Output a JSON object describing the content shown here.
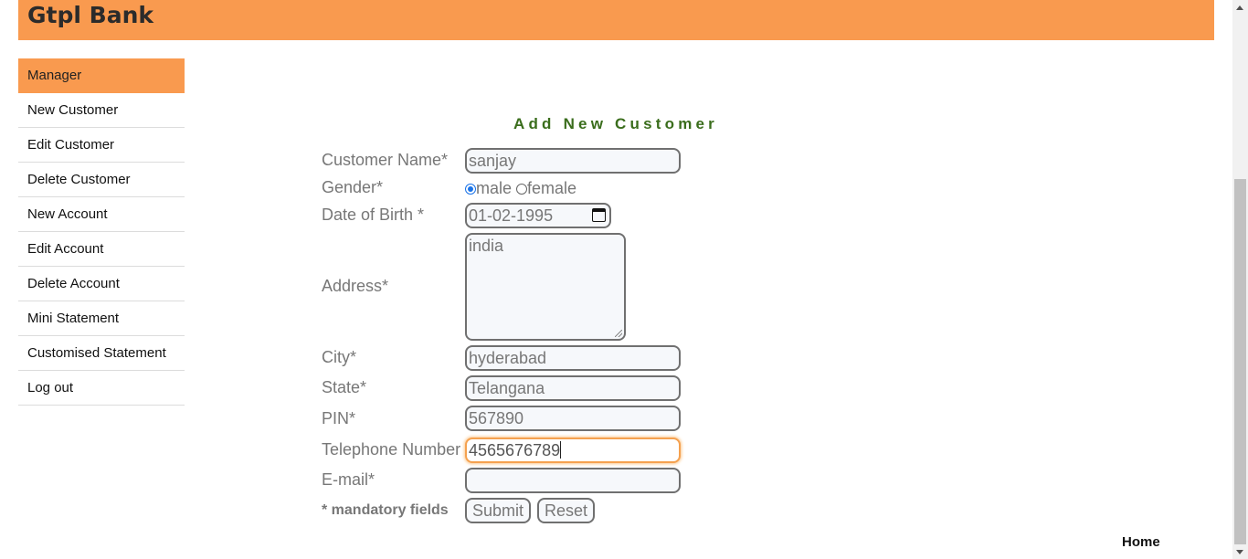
{
  "header": {
    "title": "Gtpl Bank"
  },
  "sidebar": {
    "items": [
      {
        "label": "Manager",
        "active": true
      },
      {
        "label": "New Customer"
      },
      {
        "label": "Edit Customer"
      },
      {
        "label": "Delete Customer"
      },
      {
        "label": "New Account"
      },
      {
        "label": "Edit Account"
      },
      {
        "label": "Delete Account"
      },
      {
        "label": "Mini Statement"
      },
      {
        "label": "Customised Statement"
      },
      {
        "label": "Log out"
      }
    ]
  },
  "form": {
    "title": "Add New Customer",
    "customer_name": {
      "label": "Customer Name*",
      "value": "sanjay"
    },
    "gender": {
      "label": "Gender*",
      "options": [
        "male",
        "female"
      ],
      "selected": "male"
    },
    "dob": {
      "label": "Date of Birth *",
      "value": "01-02-1995"
    },
    "address": {
      "label": "Address*",
      "value": "india"
    },
    "city": {
      "label": "City*",
      "value": "hyderabad"
    },
    "state": {
      "label": "State*",
      "value": "Telangana"
    },
    "pin": {
      "label": "PIN*",
      "value": "567890"
    },
    "telephone": {
      "label": "Telephone Number",
      "value": "4565676789"
    },
    "email": {
      "label": "E-mail*",
      "value": ""
    },
    "mandatory_note": "* mandatory fields",
    "submit_label": "Submit",
    "reset_label": "Reset"
  },
  "footer": {
    "home_label": "Home"
  },
  "colors": {
    "header_bg": "#f99a4f",
    "title_green": "#3a6d1c",
    "focus_orange": "#f5a14f",
    "radio_blue": "#1a73e8"
  }
}
